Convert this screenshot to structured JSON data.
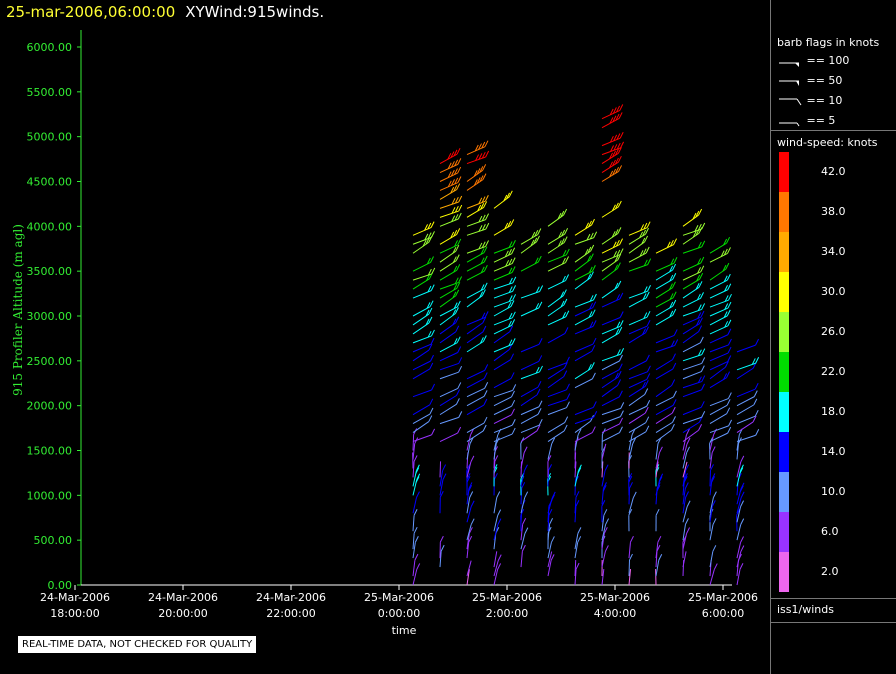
{
  "header": {
    "datetime": "25-mar-2006,06:00:00",
    "product": "XYWind:915winds."
  },
  "chart_data": {
    "type": "scatter",
    "ylabel": "915 Profiler Altitude (m agl)",
    "xlabel": "time",
    "ylim": [
      0,
      6200
    ],
    "xlim_hours": [
      -6.3,
      6.3
    ],
    "yticks": [
      "6000.00",
      "5500.00",
      "5000.00",
      "4500.00",
      "4000.00",
      "3500.00",
      "3000.00",
      "2500.00",
      "2000.00",
      "1500.00",
      "1000.00",
      "500.00",
      "0.00"
    ],
    "xticks": [
      {
        "line1": "24-Mar-2006",
        "line2": "18:00:00"
      },
      {
        "line1": "24-Mar-2006",
        "line2": "20:00:00"
      },
      {
        "line1": "24-Mar-2006",
        "line2": "22:00:00"
      },
      {
        "line1": "25-Mar-2006",
        "line2": "0:00:00"
      },
      {
        "line1": "25-Mar-2006",
        "line2": "2:00:00"
      },
      {
        "line1": "25-Mar-2006",
        "line2": "4:00:00"
      },
      {
        "line1": "25-Mar-2006",
        "line2": "6:00:00"
      }
    ],
    "profile_times_hours": [
      0.0,
      0.5,
      1.0,
      1.5,
      2.0,
      2.5,
      3.0,
      3.5,
      4.0,
      4.5,
      5.0,
      5.5,
      6.0
    ],
    "profile_tops_m": [
      3950,
      4900,
      4800,
      4200,
      3800,
      4050,
      3950,
      5350,
      3900,
      3700,
      4000,
      3700,
      2700
    ],
    "barb_style": "speed-colored wind barbs, approx. 100 m vertical spacing"
  },
  "legend": {
    "flags_title": "barb flags in knots",
    "flags": [
      "== 100",
      "== 50",
      "== 10",
      "== 5"
    ],
    "colorbar_title": "wind-speed: knots",
    "colorbar": [
      {
        "label": "42.0",
        "color": "#ff0000"
      },
      {
        "label": "38.0",
        "color": "#ff7700"
      },
      {
        "label": "34.0",
        "color": "#ffaa00"
      },
      {
        "label": "30.0",
        "color": "#ffff00"
      },
      {
        "label": "26.0",
        "color": "#99ff33"
      },
      {
        "label": "22.0",
        "color": "#00dd00"
      },
      {
        "label": "18.0",
        "color": "#00ffff"
      },
      {
        "label": "14.0",
        "color": "#0000ff"
      },
      {
        "label": "10.0",
        "color": "#6699ff"
      },
      {
        "label": "6.0",
        "color": "#9933ff"
      },
      {
        "label": "2.0",
        "color": "#ee66ee"
      }
    ],
    "source": "iss1/winds"
  },
  "disclaimer": "REAL-TIME DATA, NOT CHECKED FOR QUALITY"
}
